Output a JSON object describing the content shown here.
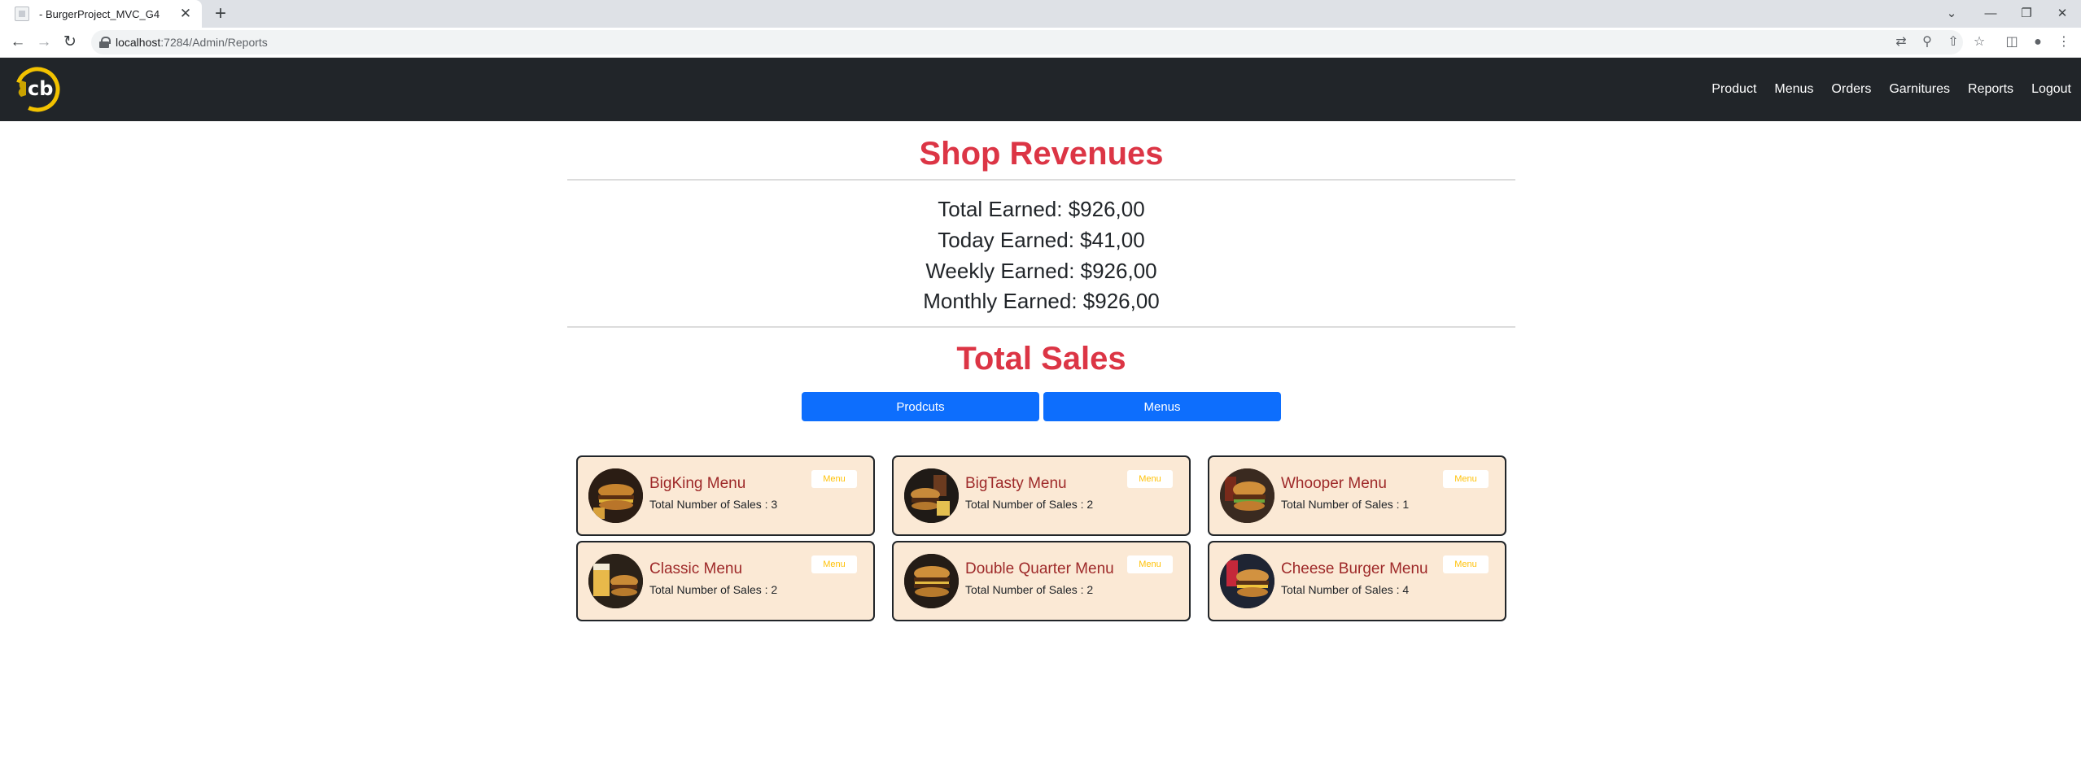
{
  "browser": {
    "tab_title": "- BurgerProject_MVC_G4",
    "close_glyph": "✕",
    "new_tab_glyph": "+",
    "url_host": "localhost",
    "url_path": ":7284/Admin/Reports",
    "window_controls": {
      "dropdown": "⌄",
      "minimize": "—",
      "restore": "❐",
      "close": "✕"
    }
  },
  "site_nav": {
    "items": [
      "Product",
      "Menus",
      "Orders",
      "Garnitures",
      "Reports",
      "Logout"
    ]
  },
  "revenues": {
    "title": "Shop Revenues",
    "lines": [
      "Total Earned: $926,00",
      "Today Earned: $41,00",
      "Weekly Earned: $926,00",
      "Monthly Earned: $926,00"
    ]
  },
  "sales": {
    "title": "Total Sales",
    "buttons": {
      "products": "Prodcuts",
      "menus": "Menus"
    }
  },
  "cards": [
    {
      "name": "BigKing Menu",
      "sales": "Total Number of Sales : 3",
      "badge": "Menu"
    },
    {
      "name": "BigTasty Menu",
      "sales": "Total Number of Sales : 2",
      "badge": "Menu"
    },
    {
      "name": "Whooper Menu",
      "sales": "Total Number of Sales : 1",
      "badge": "Menu"
    },
    {
      "name": "Classic Menu",
      "sales": "Total Number of Sales : 2",
      "badge": "Menu"
    },
    {
      "name": "Double Quarter Menu",
      "sales": "Total Number of Sales : 2",
      "badge": "Menu"
    },
    {
      "name": "Cheese Burger Menu",
      "sales": "Total Number of Sales : 4",
      "badge": "Menu"
    }
  ],
  "colors": {
    "accent_red": "#dc3545",
    "primary_blue": "#0d6efd",
    "navbar_bg": "#212529",
    "card_bg": "#fbe9d5",
    "card_title": "#9e2929",
    "badge_text": "#ffc107",
    "logo_ring": "#f2c200"
  }
}
